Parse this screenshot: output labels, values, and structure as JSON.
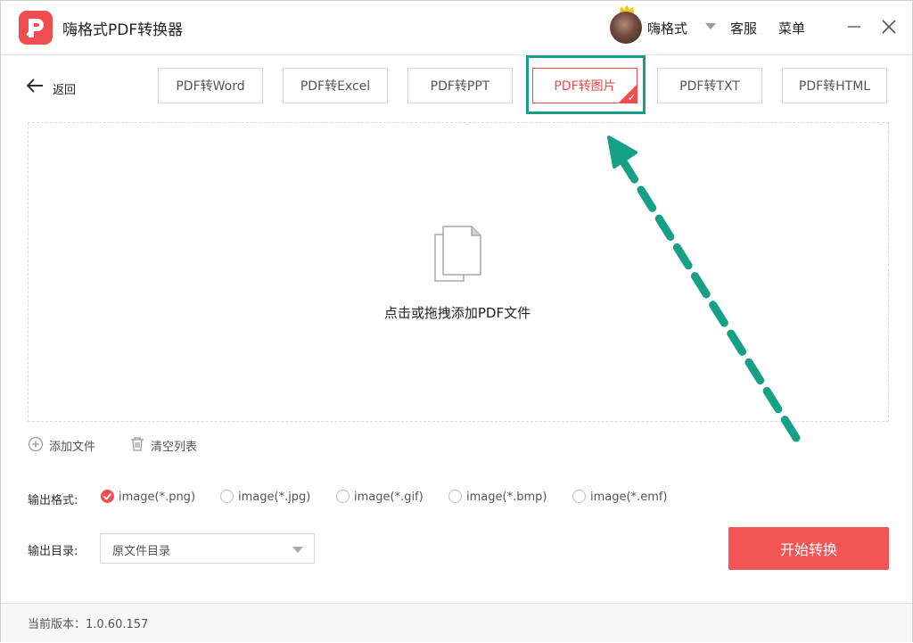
{
  "app": {
    "title": "嗨格式PDF转换器"
  },
  "header": {
    "user_name": "嗨格式",
    "service": "客服",
    "menu": "菜单"
  },
  "toolbar": {
    "back_label": "返回",
    "tabs": [
      {
        "label": "PDF转Word"
      },
      {
        "label": "PDF转Excel"
      },
      {
        "label": "PDF转PPT"
      },
      {
        "label": "PDF转图片",
        "active": true
      },
      {
        "label": "PDF转TXT"
      },
      {
        "label": "PDF转HTML"
      }
    ]
  },
  "dropzone": {
    "text": "点击或拖拽添加PDF文件"
  },
  "actions": {
    "add_file": "添加文件",
    "clear_list": "清空列表"
  },
  "output": {
    "format_label": "输出格式:",
    "formats": [
      {
        "label": "image(*.png)",
        "selected": true
      },
      {
        "label": "image(*.jpg)",
        "selected": false
      },
      {
        "label": "image(*.gif)",
        "selected": false
      },
      {
        "label": "image(*.bmp)",
        "selected": false
      },
      {
        "label": "image(*.emf)",
        "selected": false
      }
    ],
    "dir_label": "输出目录:",
    "dir_value": "原文件目录"
  },
  "start_button": "开始转换",
  "footer": {
    "version": "当前版本：1.0.60.157"
  },
  "colors": {
    "accent": "#ef4d4f",
    "annotation": "#16a085"
  }
}
